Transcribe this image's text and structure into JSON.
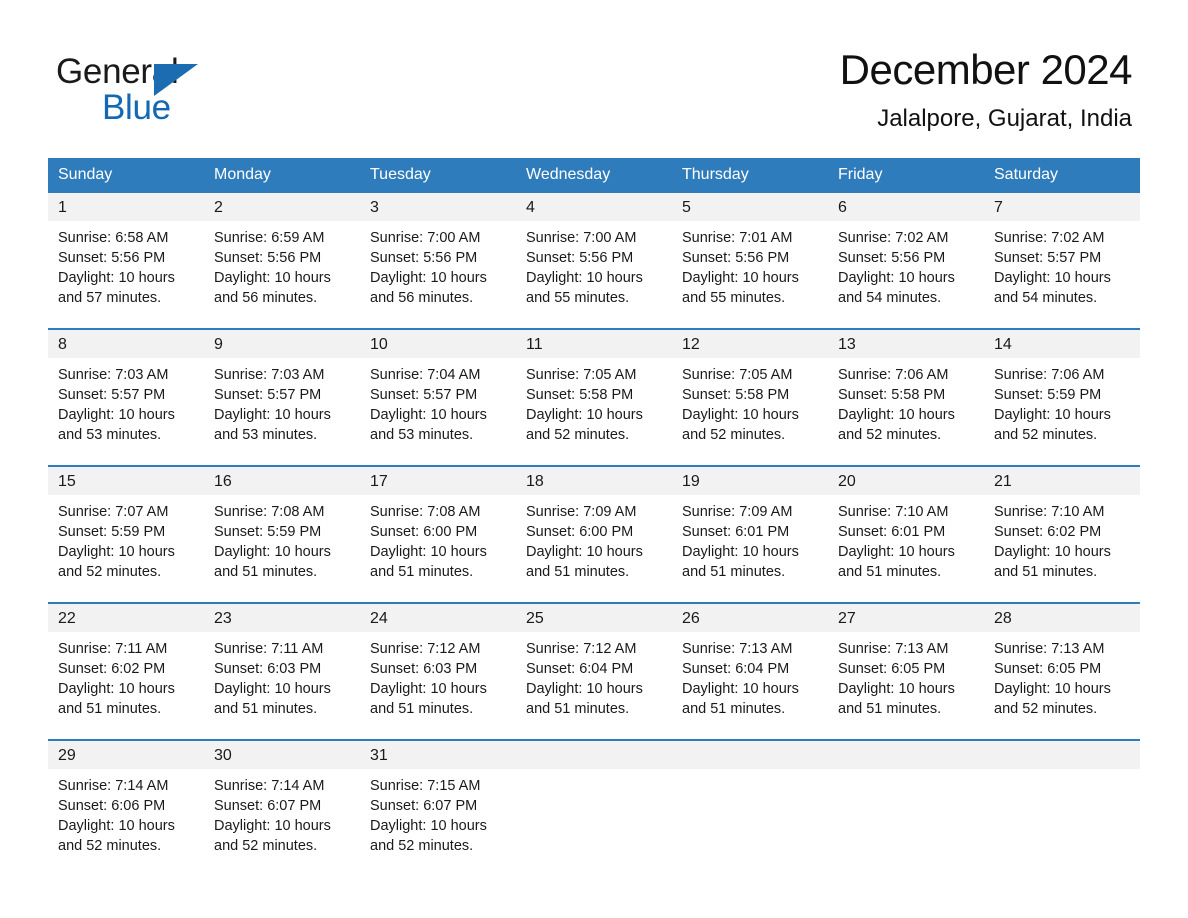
{
  "brand": {
    "name_part1": "General",
    "name_part2": "Blue",
    "triangle_color": "#1b6cb0",
    "blue_color": "#1268b3"
  },
  "header": {
    "month_title": "December 2024",
    "location": "Jalalpore, Gujarat, India"
  },
  "theme": {
    "header_blue": "#2f7cbd",
    "daynum_gray": "#f2f2f2",
    "text_color": "#1a1a1a"
  },
  "weekdays": [
    "Sunday",
    "Monday",
    "Tuesday",
    "Wednesday",
    "Thursday",
    "Friday",
    "Saturday"
  ],
  "weeks": [
    [
      {
        "day": "1",
        "sunrise": "Sunrise: 6:58 AM",
        "sunset": "Sunset: 5:56 PM",
        "daylight_line1": "Daylight: 10 hours",
        "daylight_line2": "and 57 minutes."
      },
      {
        "day": "2",
        "sunrise": "Sunrise: 6:59 AM",
        "sunset": "Sunset: 5:56 PM",
        "daylight_line1": "Daylight: 10 hours",
        "daylight_line2": "and 56 minutes."
      },
      {
        "day": "3",
        "sunrise": "Sunrise: 7:00 AM",
        "sunset": "Sunset: 5:56 PM",
        "daylight_line1": "Daylight: 10 hours",
        "daylight_line2": "and 56 minutes."
      },
      {
        "day": "4",
        "sunrise": "Sunrise: 7:00 AM",
        "sunset": "Sunset: 5:56 PM",
        "daylight_line1": "Daylight: 10 hours",
        "daylight_line2": "and 55 minutes."
      },
      {
        "day": "5",
        "sunrise": "Sunrise: 7:01 AM",
        "sunset": "Sunset: 5:56 PM",
        "daylight_line1": "Daylight: 10 hours",
        "daylight_line2": "and 55 minutes."
      },
      {
        "day": "6",
        "sunrise": "Sunrise: 7:02 AM",
        "sunset": "Sunset: 5:56 PM",
        "daylight_line1": "Daylight: 10 hours",
        "daylight_line2": "and 54 minutes."
      },
      {
        "day": "7",
        "sunrise": "Sunrise: 7:02 AM",
        "sunset": "Sunset: 5:57 PM",
        "daylight_line1": "Daylight: 10 hours",
        "daylight_line2": "and 54 minutes."
      }
    ],
    [
      {
        "day": "8",
        "sunrise": "Sunrise: 7:03 AM",
        "sunset": "Sunset: 5:57 PM",
        "daylight_line1": "Daylight: 10 hours",
        "daylight_line2": "and 53 minutes."
      },
      {
        "day": "9",
        "sunrise": "Sunrise: 7:03 AM",
        "sunset": "Sunset: 5:57 PM",
        "daylight_line1": "Daylight: 10 hours",
        "daylight_line2": "and 53 minutes."
      },
      {
        "day": "10",
        "sunrise": "Sunrise: 7:04 AM",
        "sunset": "Sunset: 5:57 PM",
        "daylight_line1": "Daylight: 10 hours",
        "daylight_line2": "and 53 minutes."
      },
      {
        "day": "11",
        "sunrise": "Sunrise: 7:05 AM",
        "sunset": "Sunset: 5:58 PM",
        "daylight_line1": "Daylight: 10 hours",
        "daylight_line2": "and 52 minutes."
      },
      {
        "day": "12",
        "sunrise": "Sunrise: 7:05 AM",
        "sunset": "Sunset: 5:58 PM",
        "daylight_line1": "Daylight: 10 hours",
        "daylight_line2": "and 52 minutes."
      },
      {
        "day": "13",
        "sunrise": "Sunrise: 7:06 AM",
        "sunset": "Sunset: 5:58 PM",
        "daylight_line1": "Daylight: 10 hours",
        "daylight_line2": "and 52 minutes."
      },
      {
        "day": "14",
        "sunrise": "Sunrise: 7:06 AM",
        "sunset": "Sunset: 5:59 PM",
        "daylight_line1": "Daylight: 10 hours",
        "daylight_line2": "and 52 minutes."
      }
    ],
    [
      {
        "day": "15",
        "sunrise": "Sunrise: 7:07 AM",
        "sunset": "Sunset: 5:59 PM",
        "daylight_line1": "Daylight: 10 hours",
        "daylight_line2": "and 52 minutes."
      },
      {
        "day": "16",
        "sunrise": "Sunrise: 7:08 AM",
        "sunset": "Sunset: 5:59 PM",
        "daylight_line1": "Daylight: 10 hours",
        "daylight_line2": "and 51 minutes."
      },
      {
        "day": "17",
        "sunrise": "Sunrise: 7:08 AM",
        "sunset": "Sunset: 6:00 PM",
        "daylight_line1": "Daylight: 10 hours",
        "daylight_line2": "and 51 minutes."
      },
      {
        "day": "18",
        "sunrise": "Sunrise: 7:09 AM",
        "sunset": "Sunset: 6:00 PM",
        "daylight_line1": "Daylight: 10 hours",
        "daylight_line2": "and 51 minutes."
      },
      {
        "day": "19",
        "sunrise": "Sunrise: 7:09 AM",
        "sunset": "Sunset: 6:01 PM",
        "daylight_line1": "Daylight: 10 hours",
        "daylight_line2": "and 51 minutes."
      },
      {
        "day": "20",
        "sunrise": "Sunrise: 7:10 AM",
        "sunset": "Sunset: 6:01 PM",
        "daylight_line1": "Daylight: 10 hours",
        "daylight_line2": "and 51 minutes."
      },
      {
        "day": "21",
        "sunrise": "Sunrise: 7:10 AM",
        "sunset": "Sunset: 6:02 PM",
        "daylight_line1": "Daylight: 10 hours",
        "daylight_line2": "and 51 minutes."
      }
    ],
    [
      {
        "day": "22",
        "sunrise": "Sunrise: 7:11 AM",
        "sunset": "Sunset: 6:02 PM",
        "daylight_line1": "Daylight: 10 hours",
        "daylight_line2": "and 51 minutes."
      },
      {
        "day": "23",
        "sunrise": "Sunrise: 7:11 AM",
        "sunset": "Sunset: 6:03 PM",
        "daylight_line1": "Daylight: 10 hours",
        "daylight_line2": "and 51 minutes."
      },
      {
        "day": "24",
        "sunrise": "Sunrise: 7:12 AM",
        "sunset": "Sunset: 6:03 PM",
        "daylight_line1": "Daylight: 10 hours",
        "daylight_line2": "and 51 minutes."
      },
      {
        "day": "25",
        "sunrise": "Sunrise: 7:12 AM",
        "sunset": "Sunset: 6:04 PM",
        "daylight_line1": "Daylight: 10 hours",
        "daylight_line2": "and 51 minutes."
      },
      {
        "day": "26",
        "sunrise": "Sunrise: 7:13 AM",
        "sunset": "Sunset: 6:04 PM",
        "daylight_line1": "Daylight: 10 hours",
        "daylight_line2": "and 51 minutes."
      },
      {
        "day": "27",
        "sunrise": "Sunrise: 7:13 AM",
        "sunset": "Sunset: 6:05 PM",
        "daylight_line1": "Daylight: 10 hours",
        "daylight_line2": "and 51 minutes."
      },
      {
        "day": "28",
        "sunrise": "Sunrise: 7:13 AM",
        "sunset": "Sunset: 6:05 PM",
        "daylight_line1": "Daylight: 10 hours",
        "daylight_line2": "and 52 minutes."
      }
    ],
    [
      {
        "day": "29",
        "sunrise": "Sunrise: 7:14 AM",
        "sunset": "Sunset: 6:06 PM",
        "daylight_line1": "Daylight: 10 hours",
        "daylight_line2": "and 52 minutes."
      },
      {
        "day": "30",
        "sunrise": "Sunrise: 7:14 AM",
        "sunset": "Sunset: 6:07 PM",
        "daylight_line1": "Daylight: 10 hours",
        "daylight_line2": "and 52 minutes."
      },
      {
        "day": "31",
        "sunrise": "Sunrise: 7:15 AM",
        "sunset": "Sunset: 6:07 PM",
        "daylight_line1": "Daylight: 10 hours",
        "daylight_line2": "and 52 minutes."
      },
      {
        "day": "",
        "sunrise": "",
        "sunset": "",
        "daylight_line1": "",
        "daylight_line2": ""
      },
      {
        "day": "",
        "sunrise": "",
        "sunset": "",
        "daylight_line1": "",
        "daylight_line2": ""
      },
      {
        "day": "",
        "sunrise": "",
        "sunset": "",
        "daylight_line1": "",
        "daylight_line2": ""
      },
      {
        "day": "",
        "sunrise": "",
        "sunset": "",
        "daylight_line1": "",
        "daylight_line2": ""
      }
    ]
  ]
}
